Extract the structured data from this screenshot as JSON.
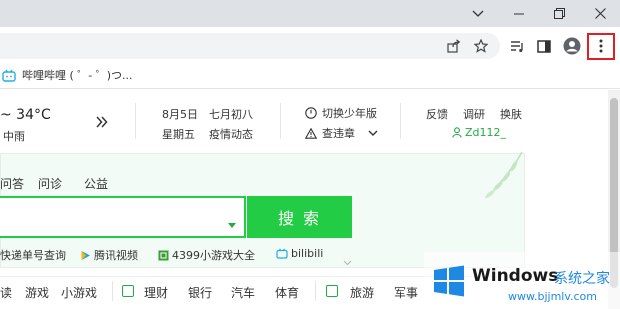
{
  "window": {
    "minimize_icon": "minimize-icon",
    "restore_icon": "restore-icon",
    "close_icon": "close-icon"
  },
  "toolbar": {
    "icons": [
      "share-icon",
      "star-icon",
      "reading-list-icon",
      "side-panel-icon",
      "profile-icon",
      "menu-dots-icon"
    ],
    "highlight_color": "#e02020"
  },
  "bookmarks": {
    "items": [
      {
        "label": "哔哩哔哩 ( ゜- ゜)つ...",
        "icon": "bilibili-icon"
      }
    ]
  },
  "weather": {
    "temp": "~ 34°C",
    "condition": "中雨"
  },
  "calendar": {
    "date": "8月5日",
    "weekday": "星期五",
    "lunar": "七月初八",
    "news": "疫情动态"
  },
  "mode": {
    "switch_label": "切换少年版",
    "rules_label": "查违章"
  },
  "top_links": {
    "feedback": "反馈",
    "survey": "调研",
    "skin": "换肤",
    "username": "Zd112_"
  },
  "search": {
    "tabs": [
      "问答",
      "问诊",
      "公益"
    ],
    "button": "搜 索",
    "accent": "#22cc44"
  },
  "quick_links": [
    {
      "label": "快递单号查询",
      "icon": ""
    },
    {
      "label": "腾讯视频",
      "icon": "tencent-video-icon"
    },
    {
      "label": "4399小游戏大全",
      "icon": "game-icon"
    },
    {
      "label": "bilibili",
      "icon": "bilibili-icon"
    }
  ],
  "categories": [
    "读",
    "游戏",
    "小游戏",
    "理财",
    "银行",
    "汽车",
    "体育",
    "旅游",
    "军事"
  ],
  "watermark": {
    "brand": "Windows",
    "tagline": "系统之家",
    "url": "www.bjjmlv.com"
  }
}
